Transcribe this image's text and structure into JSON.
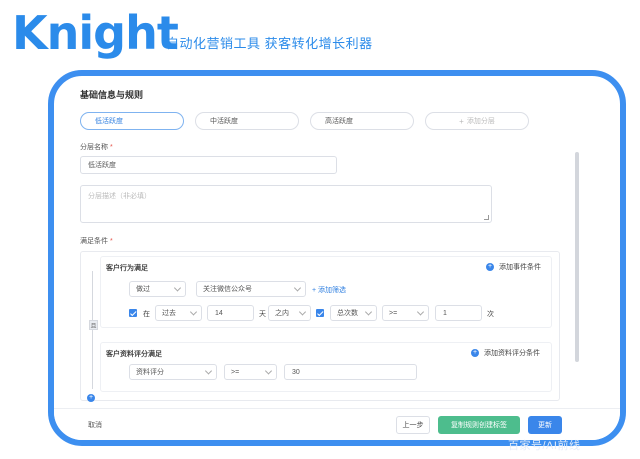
{
  "brand": {
    "logo_text": "Knight",
    "slogan": "自动化营销工具 获客转化增长利器"
  },
  "form": {
    "section_title": "基础信息与规则",
    "tabs": [
      "低活跃度",
      "中活跃度",
      "高活跃度"
    ],
    "add_tab_label": "添加分层",
    "layer_name_label": "分层名称",
    "layer_name_value": "低活跃度",
    "description_placeholder": "分层描述（非必填）",
    "condition_label": "满足条件",
    "required_mark": "*"
  },
  "behavior_group": {
    "title": "客户行为满足",
    "add_event_label": "添加事件条件",
    "event_verb": "做过",
    "event_name": "关注微信公众号",
    "add_filter_label": "+ 添加筛选",
    "in_label": "在",
    "time_mode": "过去",
    "days_value": "14",
    "day_unit": "天",
    "within": "之内",
    "metric": "总次数",
    "operator": ">=",
    "count_value": "1",
    "count_unit": "次",
    "logic_tag": "且"
  },
  "score_group": {
    "title": "客户资料评分满足",
    "add_score_label": "添加资料评分条件",
    "field": "资料评分",
    "operator": ">=",
    "value": "30"
  },
  "footer": {
    "cancel": "取消",
    "prev": "上一步",
    "copy_create": "复制规则创建标签",
    "update": "更新"
  },
  "watermark": "百家号/AI前线",
  "colors": {
    "brand_blue": "#2b8bea",
    "frame_blue": "#3d8ff0",
    "primary": "#3a86ea",
    "success": "#4dbd8d",
    "required": "#e6554b"
  }
}
